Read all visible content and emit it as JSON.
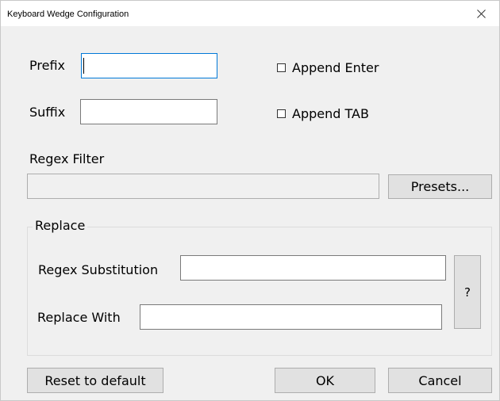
{
  "window": {
    "title": "Keyboard Wedge Configuration",
    "close_icon": "close-icon"
  },
  "form": {
    "prefix_label": "Prefix",
    "prefix_value": "",
    "suffix_label": "Suffix",
    "suffix_value": "",
    "append_enter_label": "Append Enter",
    "append_enter_checked": false,
    "append_tab_label": "Append TAB",
    "append_tab_checked": false,
    "regex_filter_label": "Regex Filter",
    "regex_filter_value": "",
    "presets_button": "Presets..."
  },
  "replace": {
    "group_label": "Replace",
    "regex_substitution_label": "Regex Substitution",
    "regex_substitution_value": "",
    "replace_with_label": "Replace With",
    "replace_with_value": "",
    "help_button": "?"
  },
  "footer": {
    "reset_button": "Reset to default",
    "ok_button": "OK",
    "cancel_button": "Cancel"
  },
  "colors": {
    "window_bg": "#f0f0f0",
    "titlebar_bg": "#ffffff",
    "focus_border": "#0078d7",
    "button_bg": "#e1e1e1"
  }
}
